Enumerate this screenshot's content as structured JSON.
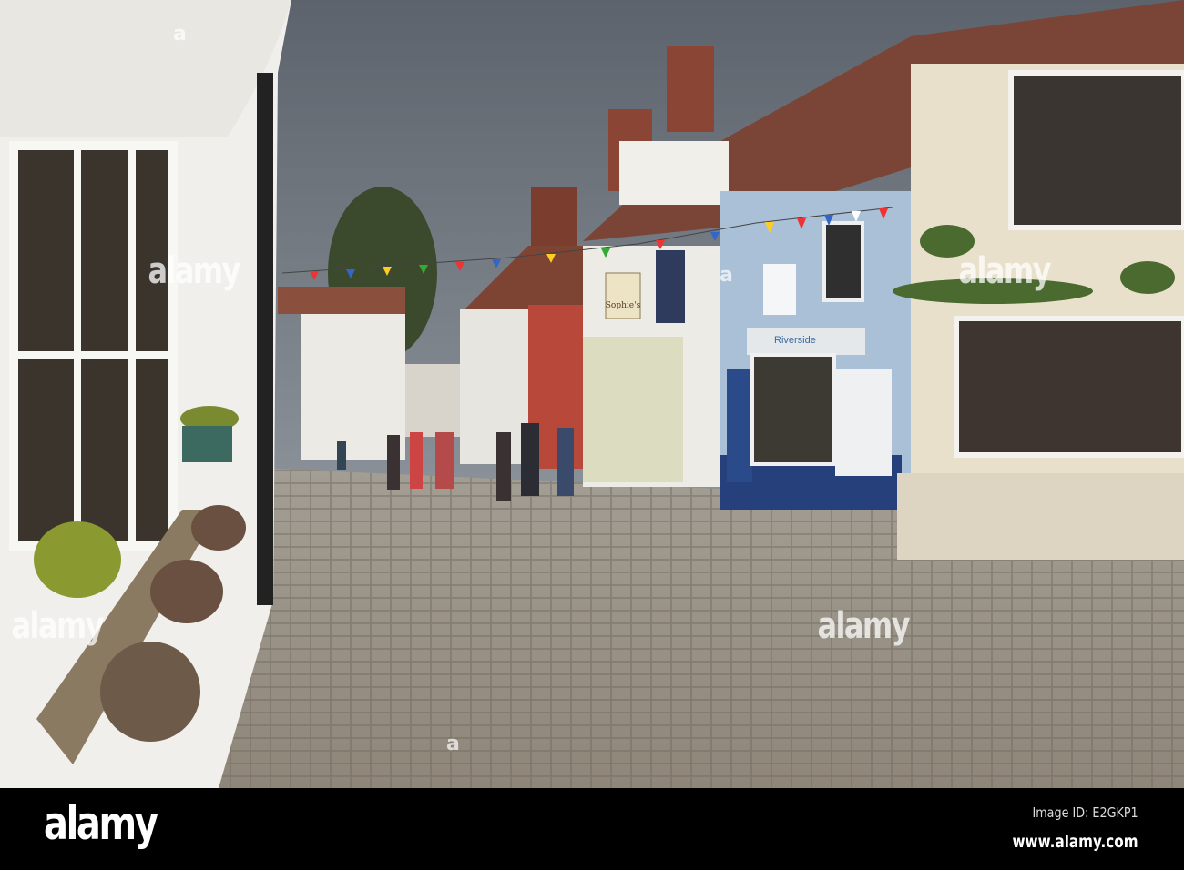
{
  "photo": {
    "signs": {
      "cafe": "Sophie's",
      "salon": "Riverside"
    },
    "watermark": "alamy",
    "watermark_mark": "a"
  },
  "footer": {
    "logo": "alamy",
    "image_id": "Image ID: E2GKP1",
    "url": "www.alamy.com"
  }
}
